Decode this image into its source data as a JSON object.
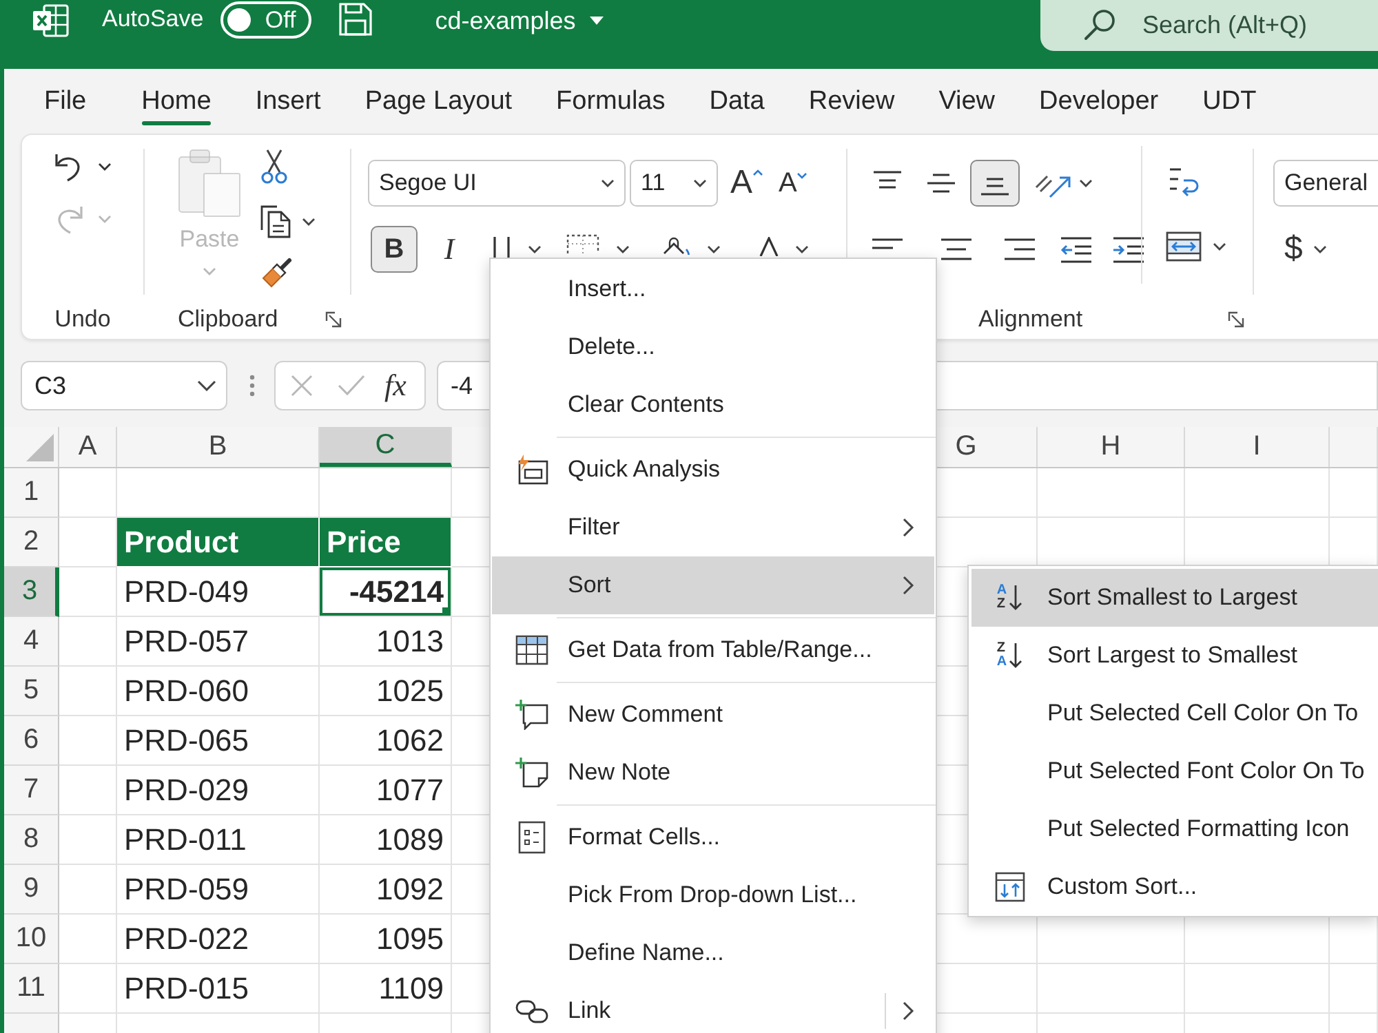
{
  "title_bar": {
    "autosave_label": "AutoSave",
    "autosave": {
      "on": false,
      "label": "Off"
    },
    "document": "cd-examples",
    "search": {
      "placeholder": "Search (Alt+Q)"
    }
  },
  "tabs": [
    {
      "label": "File",
      "selected": false
    },
    {
      "label": "Home",
      "selected": true
    },
    {
      "label": "Insert",
      "selected": false
    },
    {
      "label": "Page Layout",
      "selected": false
    },
    {
      "label": "Formulas",
      "selected": false
    },
    {
      "label": "Data",
      "selected": false
    },
    {
      "label": "Review",
      "selected": false
    },
    {
      "label": "View",
      "selected": false
    },
    {
      "label": "Developer",
      "selected": false
    },
    {
      "label": "UDT",
      "selected": false
    }
  ],
  "ribbon": {
    "undo_group": {
      "label": "Undo",
      "undo": {
        "disabled": false
      },
      "redo": {
        "disabled": true
      }
    },
    "clipboard_group": {
      "label": "Clipboard",
      "paste": {
        "label": "Paste",
        "disabled": true
      }
    },
    "font_group": {
      "font_name": "Segoe UI",
      "font_size": "11",
      "grow_font": "A",
      "shrink_font": "A",
      "bold": {
        "label": "B",
        "on": true
      },
      "italic": {
        "label": "I",
        "on": false
      }
    },
    "alignment_group": {
      "label": "Alignment",
      "vertical": [
        {
          "kind": "top",
          "selected": false
        },
        {
          "kind": "middle",
          "selected": false
        },
        {
          "kind": "bottom",
          "selected": true
        }
      ]
    },
    "number_group": {
      "format": "General",
      "currency": "$"
    }
  },
  "formula_bar": {
    "name_box": "C3",
    "edit_buttons_disabled": true,
    "function_label": "fx",
    "formula": "-4"
  },
  "sheet": {
    "columns": [
      {
        "label": "A",
        "selected": false
      },
      {
        "label": "B",
        "selected": false
      },
      {
        "label": "C",
        "selected": true
      },
      {
        "label": "G",
        "selected": false
      },
      {
        "label": "H",
        "selected": false
      },
      {
        "label": "I",
        "selected": false
      }
    ],
    "rows": [
      {
        "number": "1",
        "selected": false
      },
      {
        "number": "2",
        "selected": false,
        "kind": "header",
        "cells": [
          "Product",
          "Price"
        ]
      },
      {
        "number": "3",
        "selected": true,
        "kind": "data",
        "cells": [
          "PRD-049",
          "-45214"
        ]
      },
      {
        "number": "4",
        "selected": false,
        "kind": "data",
        "cells": [
          "PRD-057",
          "1013"
        ]
      },
      {
        "number": "5",
        "selected": false,
        "kind": "data",
        "cells": [
          "PRD-060",
          "1025"
        ]
      },
      {
        "number": "6",
        "selected": false,
        "kind": "data",
        "cells": [
          "PRD-065",
          "1062"
        ]
      },
      {
        "number": "7",
        "selected": false,
        "kind": "data",
        "cells": [
          "PRD-029",
          "1077"
        ]
      },
      {
        "number": "8",
        "selected": false,
        "kind": "data",
        "cells": [
          "PRD-011",
          "1089"
        ]
      },
      {
        "number": "9",
        "selected": false,
        "kind": "data",
        "cells": [
          "PRD-059",
          "1092"
        ]
      },
      {
        "number": "10",
        "selected": false,
        "kind": "data",
        "cells": [
          "PRD-022",
          "1095"
        ]
      },
      {
        "number": "11",
        "selected": false,
        "kind": "data",
        "cells": [
          "PRD-015",
          "1109"
        ]
      }
    ]
  },
  "context_menu": {
    "sections": [
      {
        "items": [
          {
            "label": "Insert...",
            "kind": "plain",
            "submenu": false,
            "selected": false
          },
          {
            "label": "Delete...",
            "kind": "plain",
            "submenu": false,
            "selected": false
          },
          {
            "label": "Clear Contents",
            "kind": "plain",
            "submenu": false,
            "selected": false
          }
        ]
      },
      {
        "items": [
          {
            "label": "Quick Analysis",
            "kind": "quick-analysis",
            "submenu": false,
            "selected": false
          },
          {
            "label": "Filter",
            "kind": "plain",
            "submenu": true,
            "selected": false
          },
          {
            "label": "Sort",
            "kind": "plain",
            "submenu": true,
            "selected": true
          }
        ]
      },
      {
        "items": [
          {
            "label": "Get Data from Table/Range...",
            "kind": "table",
            "submenu": false,
            "selected": false
          }
        ]
      },
      {
        "items": [
          {
            "label": "New Comment",
            "kind": "comment",
            "submenu": false,
            "selected": false
          },
          {
            "label": "New Note",
            "kind": "note",
            "submenu": false,
            "selected": false
          }
        ]
      },
      {
        "items": [
          {
            "label": "Format Cells...",
            "kind": "format",
            "submenu": false,
            "selected": false
          },
          {
            "label": "Pick From Drop-down List...",
            "kind": "plain",
            "submenu": false,
            "selected": false
          },
          {
            "label": "Define Name...",
            "kind": "plain",
            "submenu": false,
            "selected": false
          },
          {
            "label": "Link",
            "kind": "link",
            "submenu": true,
            "selected": false
          }
        ]
      }
    ]
  },
  "sort_submenu": {
    "items": [
      {
        "label": "Sort Smallest to Largest",
        "kind": "ascending",
        "icon_letters": [
          "A",
          "Z"
        ],
        "selected": true
      },
      {
        "label": "Sort Largest to Smallest",
        "kind": "descending",
        "icon_letters": [
          "Z",
          "A"
        ],
        "selected": false
      },
      {
        "label": "Put Selected Cell Color On To",
        "kind": "plain",
        "selected": false
      },
      {
        "label": "Put Selected Font Color On To",
        "kind": "plain",
        "selected": false
      },
      {
        "label": "Put Selected Formatting Icon",
        "kind": "plain",
        "selected": false
      },
      {
        "label": "Custom Sort...",
        "kind": "custom-sort",
        "selected": false
      }
    ]
  }
}
